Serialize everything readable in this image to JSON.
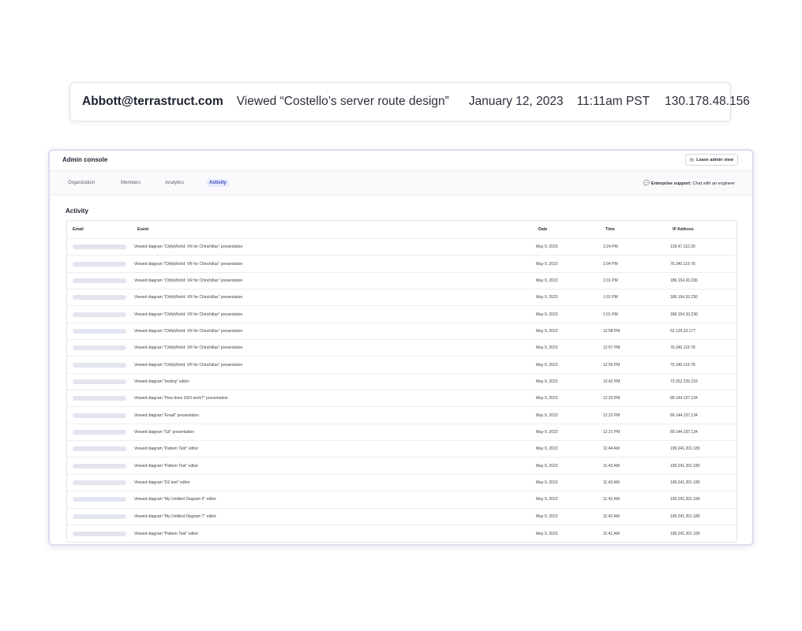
{
  "callout": {
    "email": "Abbott@terrastruct.com",
    "event": "Viewed “Costello’s server route design”",
    "date": "January 12, 2023",
    "time": "11:11am PST",
    "ip": "130.178.48.156"
  },
  "panel": {
    "title": "Admin console",
    "leave_button": "Leave admin view",
    "tabs": [
      "Organization",
      "Members",
      "Analytics",
      "Activity"
    ],
    "active_tab": "Activity",
    "support_label": "Enterprise support:",
    "support_link": "Chat with an engineer",
    "section_title": "Activity"
  },
  "table": {
    "headers": [
      "Email",
      "Event",
      "Date",
      "Time",
      "IP Address"
    ],
    "rows": [
      {
        "event": "Viewed diagram \"ChillyWorld: VR for Chinchillas\" presentation",
        "date": "May 9, 2023",
        "time": "1:24 PM",
        "ip": "139.47.110.30"
      },
      {
        "event": "Viewed diagram \"ChillyWorld: VR for Chinchillas\" presentation",
        "date": "May 9, 2023",
        "time": "1:04 PM",
        "ip": "76.240.119.78"
      },
      {
        "event": "Viewed diagram \"ChillyWorld: VR for Chinchillas\" presentation",
        "date": "May 9, 2023",
        "time": "1:01 PM",
        "ip": "186.154.33.236"
      },
      {
        "event": "Viewed diagram \"ChillyWorld: VR for Chinchillas\" presentation",
        "date": "May 9, 2023",
        "time": "1:01 PM",
        "ip": "186.154.33.236"
      },
      {
        "event": "Viewed diagram \"ChillyWorld: VR for Chinchillas\" presentation",
        "date": "May 9, 2023",
        "time": "1:01 PM",
        "ip": "186.154.33.236"
      },
      {
        "event": "Viewed diagram \"ChillyWorld: VR for Chinchillas\" presentation",
        "date": "May 9, 2023",
        "time": "12:58 PM",
        "ip": "52.124.33.177"
      },
      {
        "event": "Viewed diagram \"ChillyWorld: VR for Chinchillas\" presentation",
        "date": "May 9, 2023",
        "time": "12:57 PM",
        "ip": "76.240.119.78"
      },
      {
        "event": "Viewed diagram \"ChillyWorld: VR for Chinchillas\" presentation",
        "date": "May 9, 2023",
        "time": "12:55 PM",
        "ip": "76.240.119.78"
      },
      {
        "event": "Viewed diagram \"testing\" editor",
        "date": "May 9, 2023",
        "time": "12:42 PM",
        "ip": "73.252.226.216"
      },
      {
        "event": "Viewed diagram \"How does SSO work?\" presentation",
        "date": "May 9, 2023",
        "time": "12:23 PM",
        "ip": "89.144.197.134"
      },
      {
        "event": "Viewed diagram \"Email\" presentation",
        "date": "May 9, 2023",
        "time": "12:22 PM",
        "ip": "89.144.197.134"
      },
      {
        "event": "Viewed diagram \"Git\" presentation",
        "date": "May 9, 2023",
        "time": "12:21 PM",
        "ip": "89.144.197.134"
      },
      {
        "event": "Viewed diagram \"Pattern Test\" editor",
        "date": "May 9, 2023",
        "time": "11:44 AM",
        "ip": "199.241.201.180"
      },
      {
        "event": "Viewed diagram \"Pattern Test\" editor",
        "date": "May 9, 2023",
        "time": "11:43 AM",
        "ip": "199.241.201.180"
      },
      {
        "event": "Viewed diagram \"D2 test\" editor",
        "date": "May 9, 2023",
        "time": "11:43 AM",
        "ip": "199.241.201.180"
      },
      {
        "event": "Viewed diagram \"My Untitled Diagram 6\" editor",
        "date": "May 9, 2023",
        "time": "11:42 AM",
        "ip": "199.241.201.180"
      },
      {
        "event": "Viewed diagram \"My Untitled Diagram 7\" editor",
        "date": "May 9, 2023",
        "time": "11:42 AM",
        "ip": "199.241.201.180"
      },
      {
        "event": "Viewed diagram \"Pattern Test\" editor",
        "date": "May 9, 2023",
        "time": "11:41 AM",
        "ip": "199.241.201.180"
      }
    ]
  }
}
